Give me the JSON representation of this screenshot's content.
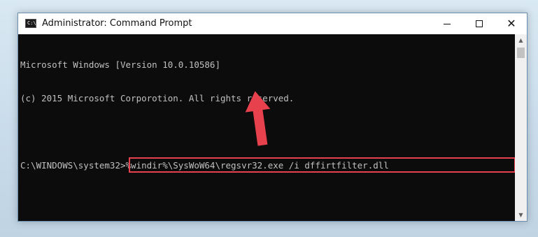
{
  "window": {
    "title": "Administrator: Command Prompt",
    "icon": "cmd-app-icon",
    "icon_text": "C:\\",
    "controls": {
      "minimize": "minimize-icon",
      "maximize": "maximize-icon",
      "close_glyph": "✕"
    }
  },
  "console": {
    "lines": [
      "Microsoft Windows [Version 10.0.10586]",
      "(c) 2015 Microsoft Corporotion. All rights reserved."
    ],
    "prompt": "C:\\WINDOWS\\system32>",
    "command": "%windir%\\SysWoW64\\regsvr32.exe /i dffirtfilter.dll"
  },
  "scrollbar": {
    "up_glyph": "▲",
    "down_glyph": "▼"
  },
  "annotation": {
    "highlight_color": "#e8414e",
    "arrow_color": "#e8414e",
    "arrow_icon": "up-arrow-icon"
  }
}
